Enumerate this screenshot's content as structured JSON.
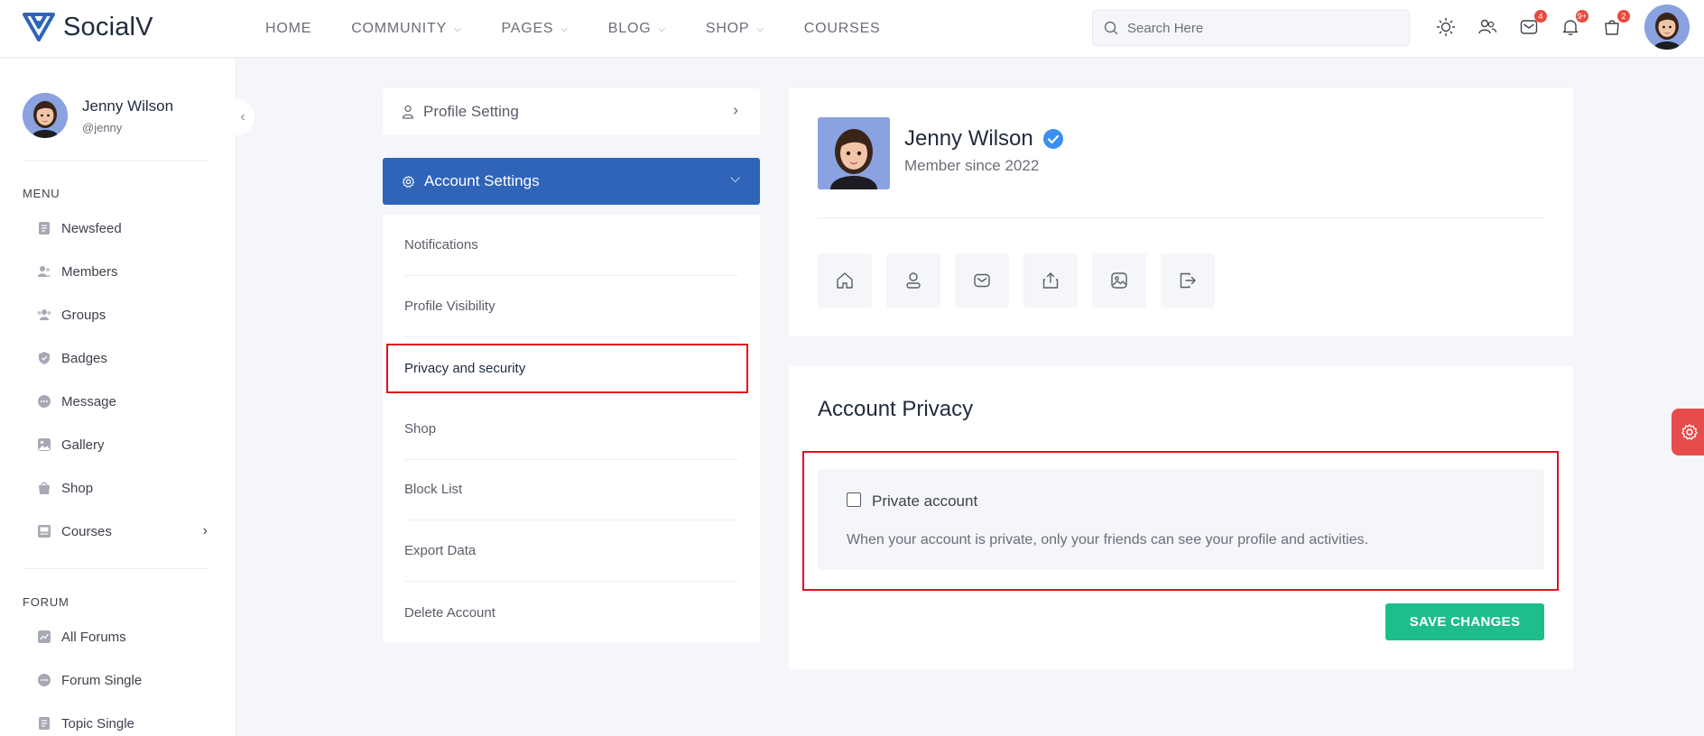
{
  "app": {
    "name": "SocialV"
  },
  "nav": {
    "items": [
      {
        "label": "HOME",
        "has_dropdown": false
      },
      {
        "label": "COMMUNITY",
        "has_dropdown": true
      },
      {
        "label": "PAGES",
        "has_dropdown": true
      },
      {
        "label": "BLOG",
        "has_dropdown": true
      },
      {
        "label": "SHOP",
        "has_dropdown": true
      },
      {
        "label": "COURSES",
        "has_dropdown": false
      }
    ]
  },
  "search": {
    "placeholder": "Search Here"
  },
  "top_icons": {
    "messages_badge": "4",
    "notifications_badge": "9+",
    "cart_badge": "2"
  },
  "user": {
    "name": "Jenny Wilson",
    "handle": "@jenny"
  },
  "sidebar": {
    "menu_title": "MENU",
    "menu": [
      {
        "label": "Newsfeed",
        "icon": "newsfeed-icon"
      },
      {
        "label": "Members",
        "icon": "members-icon"
      },
      {
        "label": "Groups",
        "icon": "groups-icon"
      },
      {
        "label": "Badges",
        "icon": "badge-icon"
      },
      {
        "label": "Message",
        "icon": "message-icon"
      },
      {
        "label": "Gallery",
        "icon": "gallery-icon"
      },
      {
        "label": "Shop",
        "icon": "shop-bag-icon"
      },
      {
        "label": "Courses",
        "icon": "courses-icon"
      }
    ],
    "forum_title": "FORUM",
    "forum": [
      {
        "label": "All Forums",
        "icon": "forums-icon"
      },
      {
        "label": "Forum Single",
        "icon": "forum-chat-icon"
      },
      {
        "label": "Topic Single",
        "icon": "topic-icon"
      }
    ]
  },
  "settings": {
    "profile_setting": "Profile Setting",
    "account_settings": "Account Settings",
    "sub_items": [
      "Notifications",
      "Profile Visibility",
      "Privacy and security",
      "Shop",
      "Block List",
      "Export Data",
      "Delete Account"
    ],
    "active_item": "Privacy and security"
  },
  "profile_card": {
    "name": "Jenny Wilson",
    "member_since": "Member since 2022"
  },
  "privacy": {
    "title": "Account Privacy",
    "checkbox_label": "Private account",
    "description": "When your account is private, only your friends can see your profile and activities.",
    "save_label": "SAVE CHANGES"
  },
  "colors": {
    "brand_blue": "#2f64b9",
    "save_green": "#1ebe8c",
    "badge_red": "#e74c3c",
    "highlight_red": "#e3101b"
  }
}
